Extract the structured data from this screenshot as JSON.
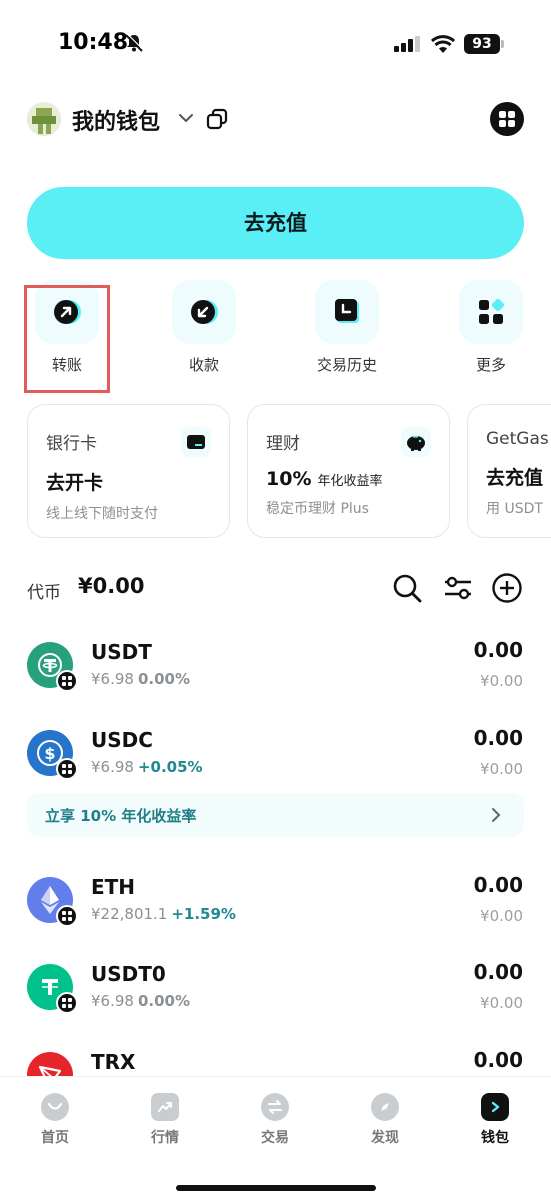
{
  "status": {
    "time": "10:48",
    "battery": "93"
  },
  "header": {
    "wallet_name": "我的钱包"
  },
  "deposit_label": "去充值",
  "actions": [
    {
      "label": "转账",
      "icon": "arrow-up-right-icon"
    },
    {
      "label": "收款",
      "icon": "arrow-down-left-icon"
    },
    {
      "label": "交易历史",
      "icon": "history-icon"
    },
    {
      "label": "更多",
      "icon": "grid-icon"
    }
  ],
  "cards": [
    {
      "title": "银行卡",
      "main": "去开卡",
      "main_small": "",
      "sub": "线上线下随时支付",
      "icon": "bank-card-icon"
    },
    {
      "title": "理财",
      "main": "10%",
      "main_small": "年化收益率",
      "sub": "稳定币理财 Plus",
      "icon": "piggy-bank-icon"
    },
    {
      "title": "GetGas",
      "main": "去充值",
      "main_small": "",
      "sub": "用 USDT",
      "icon": ""
    }
  ],
  "tokens_header": {
    "label": "代币",
    "total": "¥0.00"
  },
  "tokens": [
    {
      "name": "USDT",
      "price": "¥6.98",
      "change": "0.00%",
      "balance": "0.00",
      "fiat": "¥0.00",
      "color": "#26a17b"
    },
    {
      "name": "USDC",
      "price": "¥6.98",
      "change": "+0.05%",
      "balance": "0.00",
      "fiat": "¥0.00",
      "color": "#2775ca"
    },
    {
      "name": "ETH",
      "price": "¥22,801.1",
      "change": "+1.59%",
      "balance": "0.00",
      "fiat": "¥0.00",
      "color": "#627eea"
    },
    {
      "name": "USDT0",
      "price": "¥6.98",
      "change": "0.00%",
      "balance": "0.00",
      "fiat": "¥0.00",
      "color": "#00c08b"
    },
    {
      "name": "TRX",
      "price": "",
      "change": "",
      "balance": "0.00",
      "fiat": "",
      "color": "#e5252a"
    }
  ],
  "promo": {
    "text": "立享 10% 年化收益率"
  },
  "nav": [
    {
      "label": "首页",
      "icon": "home-icon"
    },
    {
      "label": "行情",
      "icon": "market-icon"
    },
    {
      "label": "交易",
      "icon": "swap-icon"
    },
    {
      "label": "发现",
      "icon": "discover-icon"
    },
    {
      "label": "钱包",
      "icon": "wallet-icon"
    }
  ],
  "colors": {
    "accent": "#5aeef5",
    "highlight": "#e35a5a",
    "positive": "#1f8a8f"
  }
}
